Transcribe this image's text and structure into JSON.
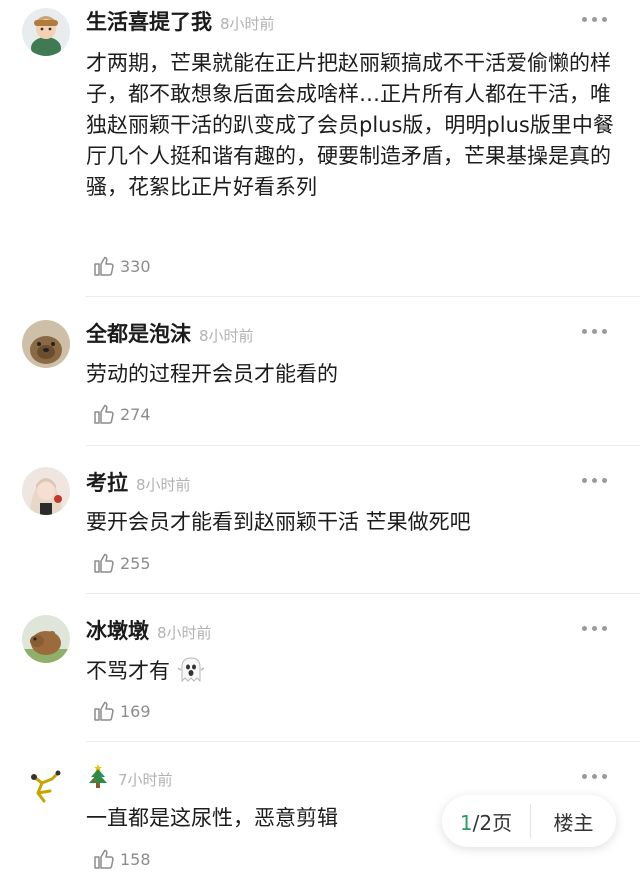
{
  "comments": [
    {
      "username": "生活喜提了我",
      "time": "8小时前",
      "text": "才两期，芒果就能在正片把赵丽颖搞成不干活爱偷懒的样子，都不敢想象后面会成啥样…正片所有人都在干活，唯独赵丽颖干活的趴变成了会员plus版，明明plus版里中餐厅几个人挺和谐有趣的，硬要制造矛盾，芒果基操是真的骚，花絮比正片好看系列",
      "likes": "330"
    },
    {
      "username": "全都是泡沫",
      "time": "8小时前",
      "text": "劳动的过程开会员才能看的",
      "likes": "274"
    },
    {
      "username": "考拉",
      "time": "8小时前",
      "text": "要开会员才能看到赵丽颖干活 芒果做死吧",
      "likes": "255"
    },
    {
      "username": "冰墩墩",
      "time": "8小时前",
      "text": "不骂才有",
      "text_emoji": "ghost-emoji",
      "likes": "169"
    },
    {
      "username_icon": "christmas-tree-emoji",
      "time": "7小时前",
      "text": "一直都是这尿性，恶意剪辑",
      "likes": "158"
    }
  ],
  "pager": {
    "current": "1",
    "rest": "/2页",
    "owner_label": "楼主"
  },
  "colors": {
    "accent_green": "#2f9c62",
    "meta_gray": "#b2b2b2"
  }
}
